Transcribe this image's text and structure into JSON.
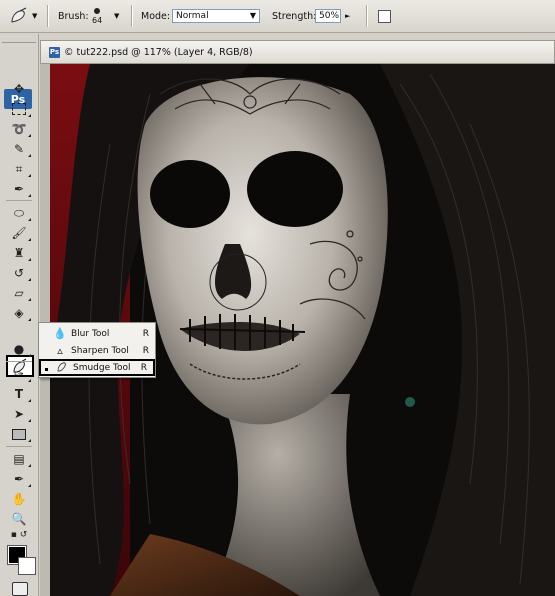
{
  "options_bar": {
    "brush_label": "Brush:",
    "brush_size": "64",
    "mode_label": "Mode:",
    "mode_value": "Normal",
    "strength_label": "Strength:",
    "strength_value": "50%"
  },
  "toolbox": {
    "logo": "Ps"
  },
  "document": {
    "title": "© tut222.psd @ 117% (Layer 4, RGB/8)"
  },
  "flyout": {
    "items": [
      {
        "label": "Blur Tool",
        "shortcut": "R"
      },
      {
        "label": "Sharpen Tool",
        "shortcut": "R"
      },
      {
        "label": "Smudge Tool",
        "shortcut": "R"
      }
    ],
    "selected_index": 2
  },
  "colors": {
    "accent": "#2e63a6",
    "background_red": "#6a0c10"
  }
}
